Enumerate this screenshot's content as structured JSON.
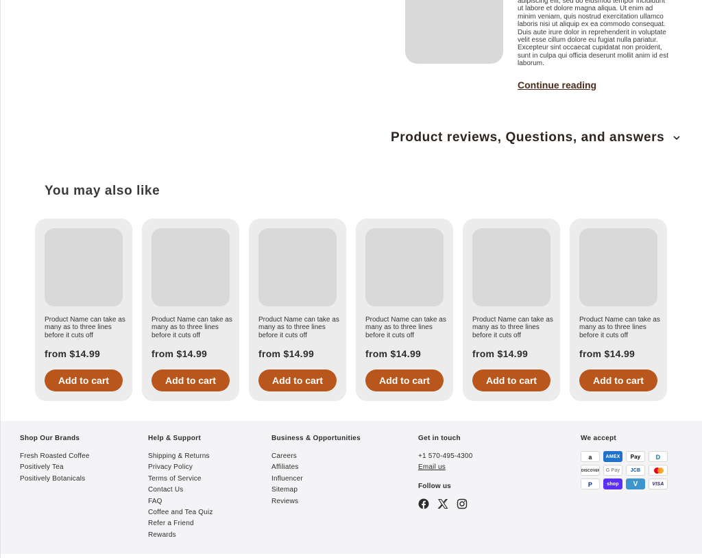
{
  "product": {
    "description": "adipiscing elit, sed do eiusmod tempor incididunt ut labore et dolore magna aliqua. Ut enim ad minim veniam, quis nostrud exercitation ullamco laboris nisi ut aliquip ex ea commodo consequat. Duis aute irure dolor in reprehenderit in voluptate velit esse cillum dolore eu fugiat nulla pariatur. Excepteur sint occaecat cupidatat non proident, sunt in culpa qui officia deserunt mollit anim id est laborum.",
    "continue_label": "Continue reading"
  },
  "reviews_heading": "Product reviews, Questions, and answers",
  "related": {
    "heading": "You may also like",
    "cards": [
      {
        "name": "Product Name can take as many as to three lines before it cuts off",
        "price": "from $14.99",
        "button": "Add to cart"
      },
      {
        "name": "Product Name can take as many as to three lines before it cuts off",
        "price": "from $14.99",
        "button": "Add to cart"
      },
      {
        "name": "Product Name can take as many as to three lines before it cuts off",
        "price": "from $14.99",
        "button": "Add to cart"
      },
      {
        "name": "Product Name can take as many as to three lines before it cuts off",
        "price": "from $14.99",
        "button": "Add to cart"
      },
      {
        "name": "Product Name can take as many as to three lines before it cuts off",
        "price": "from $14.99",
        "button": "Add to cart"
      },
      {
        "name": "Product Name can take as many as to three lines before it cuts off",
        "price": "from $14.99",
        "button": "Add to cart"
      }
    ]
  },
  "footer": {
    "brands": {
      "heading": "Shop Our Brands",
      "links": [
        "Fresh Roasted Coffee",
        "Positively Tea",
        "Positively Botanicals"
      ]
    },
    "support": {
      "heading": "Help & Support",
      "links": [
        "Shipping & Returns",
        "Privacy Policy",
        "Terms of Service",
        "Contact Us",
        "FAQ",
        "Coffee and Tea Quiz",
        "Refer a Friend",
        "Rewards"
      ]
    },
    "business": {
      "heading": "Business & Opportunities",
      "links": [
        "Careers",
        "Affiliates",
        "Influencer",
        "Sitemap",
        "Reviews"
      ]
    },
    "contact": {
      "heading": "Get in touch",
      "phone": "+1 570-495-4300",
      "email": "Email us",
      "follow": "Follow us",
      "social": [
        "facebook-icon",
        "x-icon",
        "instagram-icon"
      ]
    },
    "payments": {
      "heading": "We accept",
      "methods": [
        "a",
        "AMEX",
        "Pay",
        "D",
        "DISCOVER",
        "G Pay",
        "JCB",
        "MC",
        "P",
        "shop",
        "V",
        "VISA"
      ]
    }
  },
  "colors": {
    "accent": "#b8561b",
    "link_dark": "#4a2c1b",
    "card_bg": "#ececec",
    "footer_bg": "#f4f4f6"
  }
}
